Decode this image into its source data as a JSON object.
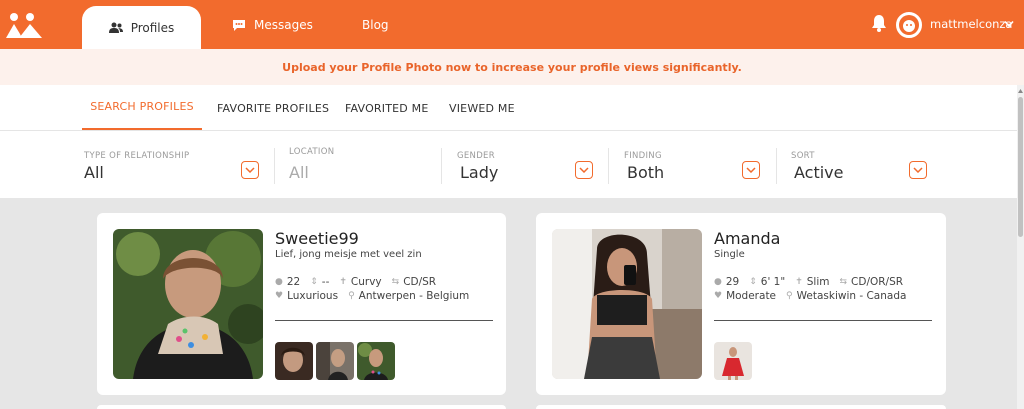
{
  "brand": {
    "accent": "#f26b2d",
    "notice_bg": "#fdf1ec"
  },
  "nav": {
    "tabs": [
      {
        "label": "Profiles",
        "icon": "users-icon",
        "active": true
      },
      {
        "label": "Messages",
        "icon": "chat-icon"
      },
      {
        "label": "Blog"
      }
    ],
    "username": "mattmelconza"
  },
  "notice": {
    "text": "Upload your Profile Photo now to increase your profile views significantly."
  },
  "subtabs": [
    "SEARCH PROFILES",
    "FAVORITE PROFILES",
    "FAVORITED ME",
    "VIEWED ME"
  ],
  "filters": [
    {
      "label": "TYPE OF RELATIONSHIP",
      "value": "All"
    },
    {
      "label": "LOCATION",
      "value": "All"
    },
    {
      "label": "GENDER",
      "value": "Lady"
    },
    {
      "label": "FINDING",
      "value": "Both"
    },
    {
      "label": "SORT",
      "value": "Active"
    }
  ],
  "profiles": [
    {
      "name": "Sweetie99",
      "tagline": "Lief, jong meisje met veel zin",
      "age": "22",
      "height": "--",
      "body": "Curvy",
      "looking_for": "CD/SR",
      "lifestyle": "Luxurious",
      "location": "Antwerpen - Belgium"
    },
    {
      "name": "Amanda",
      "tagline": "Single",
      "age": "29",
      "height": "6' 1\"",
      "body": "Slim",
      "looking_for": "CD/OR/SR",
      "lifestyle": "Moderate",
      "location": "Wetaskiwin - Canada"
    }
  ]
}
